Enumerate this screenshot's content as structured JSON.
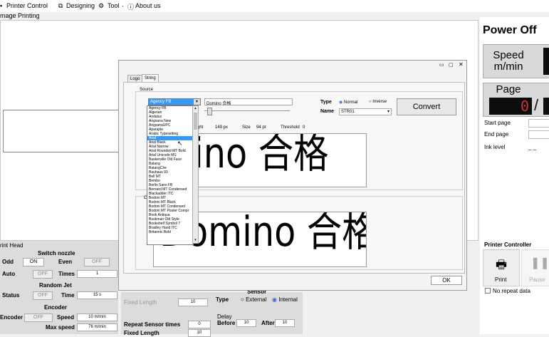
{
  "menu": {
    "printer_control": "Printer Control",
    "designing": "Designing",
    "tool": "Tool",
    "tool_caret": "·",
    "about": "About us"
  },
  "subtitle": "mage Printing",
  "right_panel": {
    "power_status": "Power Off",
    "speed_label": "Speed m/min",
    "page_label": "Page",
    "page_value": "0",
    "start_page": "Start page",
    "end_page": "End page",
    "ink_level": "Ink level",
    "ink_value": "_ _",
    "printer_controller": "Printer Controller",
    "print": "Print",
    "pause": "Pause",
    "no_repeat": "No repeat data"
  },
  "print_head": {
    "title": "rint Head",
    "switch_nozzle": "Switch nozzle",
    "odd": "Odd",
    "odd_state": "ON",
    "even": "Even",
    "even_state": "OFF",
    "auto": "Auto",
    "auto_state": "OFF",
    "times": "Times",
    "times_value": "1",
    "random_jet": "Random Jet",
    "status": "Status",
    "status_state": "OFF",
    "time": "Time",
    "time_value": "15 s",
    "encoder_title": "Encoder",
    "encoder": "Encoder",
    "encoder_state": "OFF",
    "speed": "Speed",
    "speed_value": "10 m/min",
    "max_speed": "Max speed",
    "max_speed_value": "76 m/min"
  },
  "bottom_mid": {
    "fixed_length": "Fixed Length",
    "fixed_length_value": "10",
    "repeat_sensor": "Repeat Sensor times",
    "repeat_sensor_value": "0",
    "fixed_length2": "Fixed Length",
    "fixed_length2_value": "10",
    "sensor": "Sensor",
    "type": "Type",
    "external": "External",
    "internal": "Internal",
    "delay": "Delay",
    "before": "Before",
    "before_value": "10",
    "after": "After",
    "after_value": "10"
  },
  "dialog": {
    "tab_logo": "Logo",
    "tab_string": "String",
    "source": "Source",
    "font_selected": "Agency FB",
    "text_value": "Domino 合格",
    "type_label": "Type",
    "normal": "Normal",
    "inverse": "Inverse",
    "name_label": "Name",
    "name_value": "STR01",
    "convert": "Convert",
    "height_label": "ght",
    "height_value": "149 px",
    "size_label": "Size",
    "size_value": "94 pt",
    "threshold_label": "Threshold",
    "threshold_value": "0",
    "conv_label": "Conv",
    "preview_top": "mino 合格",
    "preview_bottom": "Domino 合格",
    "ok": "OK",
    "fonts": [
      "Agency FB",
      "Algerian",
      "Andalus",
      "Angsana New",
      "AngsanaUPC",
      "Aparajita",
      "Arabic Typesetting",
      "Arial",
      "Arial Black",
      "Arial Narrow",
      "Arial Rounded MT Bold",
      "Arial Unicode MS",
      "Baskerville Old Face",
      "Batang",
      "BatangChe",
      "Bauhaus 93",
      "Bell MT",
      "Bembo",
      "Berlin Sans FB",
      "Bernard MT Condensed",
      "Blackadder ITC",
      "Bodoni MT",
      "Bodoni MT Black",
      "Bodoni MT Condensed",
      "Bodoni MT Poster Compr",
      "Book Antiqua",
      "Bookman Old Style",
      "Bookshelf Symbol 7",
      "Bradley Hand ITC",
      "Britannic Bold"
    ],
    "selected_index": 7
  },
  "colors": {
    "accent": "#3399ff",
    "seven_seg": "#0d0d0d",
    "seg_highlight": "#cc3333"
  }
}
